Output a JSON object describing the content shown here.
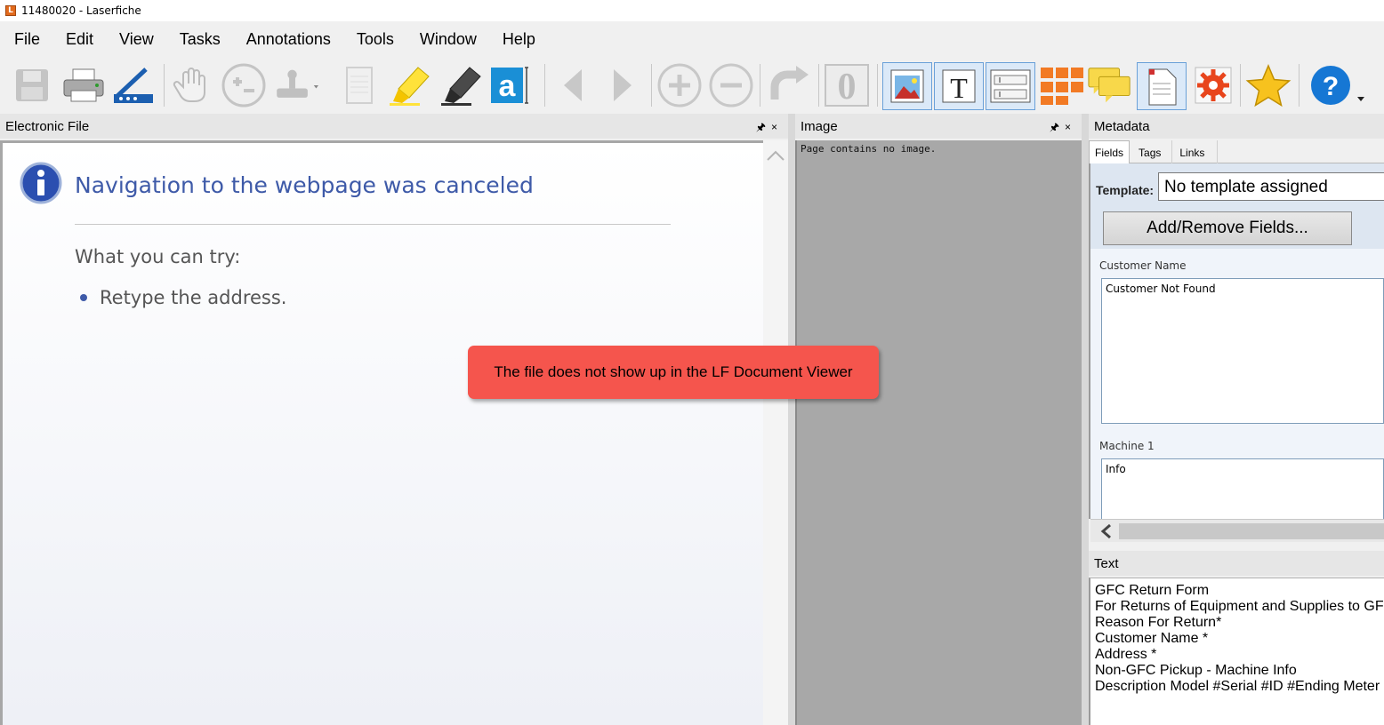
{
  "window": {
    "title": "11480020 - Laserfiche",
    "logo_letter": "L"
  },
  "menu": [
    "File",
    "Edit",
    "View",
    "Tasks",
    "Annotations",
    "Tools",
    "Window",
    "Help"
  ],
  "toolbar": {
    "icons": [
      "save-icon",
      "print-icon",
      "scan-icon",
      "hand-pan-icon",
      "zoom-icon",
      "stamp-icon",
      "blank-page-icon",
      "highlighter-icon",
      "marker-icon",
      "text-annotation-icon",
      "previous-page-icon",
      "next-page-icon",
      "zoom-in-icon",
      "zoom-out-icon",
      "rotate-icon",
      "ocr-icon",
      "image-pane-icon",
      "text-pane-icon",
      "metadata-pane-icon",
      "thumbnails-icon",
      "annotations-list-icon",
      "document-icon",
      "settings-gear-icon",
      "favorite-star-icon",
      "help-icon"
    ],
    "text_annotation_glyph": "a",
    "text_pane_glyph": "T",
    "ocr_glyph": "0",
    "help_glyph": "?"
  },
  "panels": {
    "electronic_file": {
      "title": "Electronic File"
    },
    "image": {
      "title": "Image",
      "message": "Page contains no image."
    },
    "metadata": {
      "title": "Metadata",
      "tabs": [
        "Fields",
        "Tags",
        "Links"
      ],
      "template_label": "Template:",
      "template_value": "No template assigned",
      "add_remove_button": "Add/Remove Fields...",
      "fields": [
        {
          "label": "Customer Name",
          "value": "Customer Not Found"
        },
        {
          "label": "Machine 1",
          "value": "Info"
        }
      ]
    },
    "text": {
      "title": "Text",
      "lines": [
        "GFC Return Form",
        "For Returns of Equipment and Supplies to GFC",
        "Reason For Return*",
        "Customer Name *",
        "Address *",
        "Non-GFC Pickup - Machine Info",
        "Description Model #Serial #ID #Ending Meter R"
      ]
    }
  },
  "pane_controls": {
    "pin": "🖈",
    "close": "×"
  },
  "browser_error": {
    "title": "Navigation to the webpage was canceled",
    "try_label": "What you can try:",
    "suggestions": [
      "Retype the address."
    ]
  },
  "callout": {
    "text": "The file does not show up in the LF Document Viewer",
    "color": "#f5554d"
  },
  "colors": {
    "accent_blue": "#3e5aa8",
    "pressed_blue": "#dbe9f8"
  }
}
